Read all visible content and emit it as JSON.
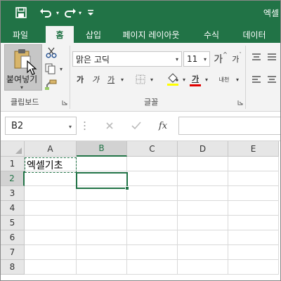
{
  "window": {
    "title_partial": "엑셀"
  },
  "qat": {
    "save_icon": "save-icon",
    "undo_icon": "undo-icon",
    "redo_icon": "redo-icon",
    "customize_icon": "customize-qat-icon"
  },
  "tabs": [
    {
      "label": "파일",
      "active": false
    },
    {
      "label": "홈",
      "active": true
    },
    {
      "label": "삽입",
      "active": false
    },
    {
      "label": "페이지 레이아웃",
      "active": false
    },
    {
      "label": "수식",
      "active": false
    },
    {
      "label": "데이터",
      "active": false
    }
  ],
  "clipboard": {
    "paste_label": "붙여넣기",
    "group_label": "클립보드"
  },
  "font": {
    "name": "맑은 고딕",
    "size": "11",
    "grow_label": "가",
    "shrink_label": "가",
    "bold_label": "가",
    "italic_label": "가",
    "underline_label": "가",
    "font_color_label": "가",
    "phonetic_label": "내천",
    "group_label": "글꼴"
  },
  "formula_bar": {
    "name_box": "B2",
    "fx_label": "fx",
    "value": ""
  },
  "grid": {
    "columns": [
      "A",
      "B",
      "C",
      "D",
      "E"
    ],
    "rows": [
      "1",
      "2",
      "3",
      "4",
      "5",
      "6",
      "7",
      "8"
    ],
    "selected_column": "B",
    "selected_row": "2",
    "cells": {
      "A1": "엑셀기초"
    }
  },
  "colors": {
    "accent": "#217346",
    "ribbon_bg": "#f3f3f3",
    "header_bg": "#e6e6e6",
    "font_color_underline": "#e00000",
    "fill_color": "#ffff00"
  }
}
